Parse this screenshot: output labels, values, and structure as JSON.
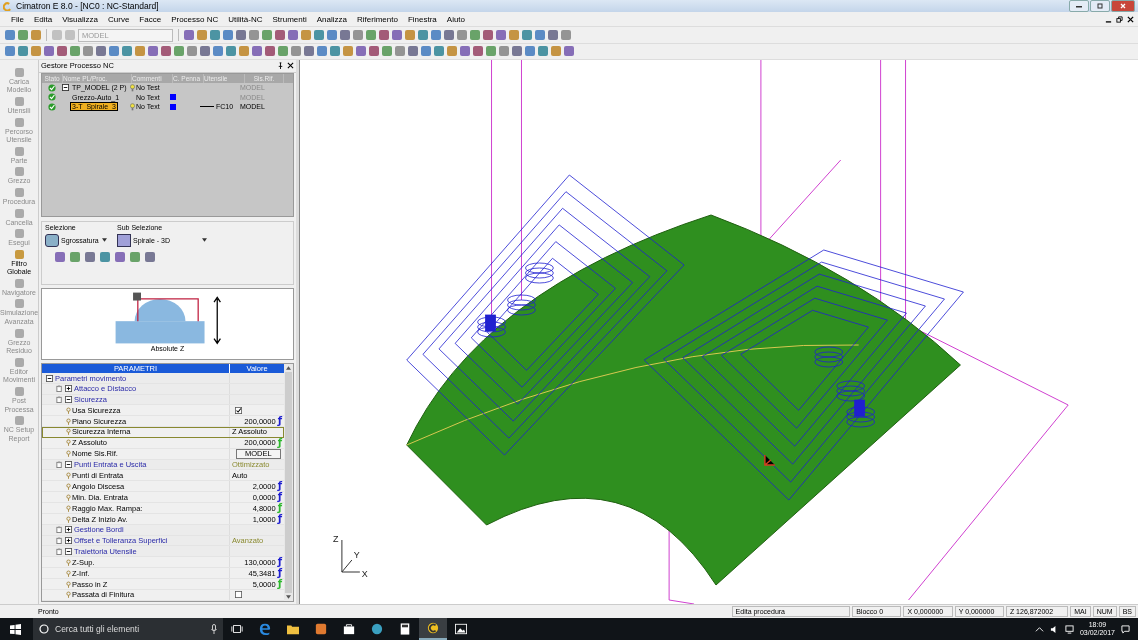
{
  "window": {
    "title": "Cimatron E 8.0 - [NC0 : NC-Standard]"
  },
  "menu": [
    "File",
    "Edita",
    "Visualizza",
    "Curve",
    "Facce",
    "Processo NC",
    "Utilità-NC",
    "Strumenti",
    "Analizza",
    "Riferimento",
    "Finestra",
    "Aiuto"
  ],
  "toolbar": {
    "model_field": {
      "value": "MODEL",
      "disabled": true
    }
  },
  "sidebar": {
    "items": [
      {
        "label": "Carica Modello",
        "disabled": true
      },
      {
        "label": "Utensili",
        "disabled": true
      },
      {
        "label": "Percorso Utensile",
        "disabled": true
      },
      {
        "label": "Parte",
        "disabled": true
      },
      {
        "label": "Grezzo",
        "disabled": true
      },
      {
        "label": "Procedura",
        "disabled": true
      },
      {
        "label": "Cancella",
        "disabled": true
      },
      {
        "label": "Esegui",
        "disabled": true
      },
      {
        "label": "Filtro Globale",
        "disabled": false
      },
      {
        "label": "Navigatore",
        "disabled": true
      },
      {
        "label": "Simulazione Avanzata",
        "disabled": true
      },
      {
        "label": "Grezzo Residuo",
        "disabled": true
      },
      {
        "label": "Editor Movimenti",
        "disabled": true
      },
      {
        "label": "Post Processa",
        "disabled": true
      },
      {
        "label": "NC Setup Report",
        "disabled": true
      }
    ]
  },
  "process_manager": {
    "title": "Gestore Processo NC",
    "columns": [
      "Stato",
      "Nome PL/Proc.",
      "Commenti",
      "C. Penna",
      "Utensile",
      "Sis.Rif."
    ],
    "rows": [
      {
        "name": "TP_MODEL (2 P)",
        "expanded": true,
        "bulb": true,
        "comment": "No Test",
        "sys": "MODEL",
        "dimmed": true,
        "selected": false
      },
      {
        "name": "Grezzo-Auto_1",
        "bulb": false,
        "comment": "No Text",
        "color": "#0000ff",
        "sys": "MODEL",
        "dimmed": true,
        "selected": false
      },
      {
        "name": "3-T_Spirale_3",
        "bulb": true,
        "comment": "No Text",
        "color": "#0000ff",
        "tool": "FC10",
        "sys": "MODEL",
        "dimmed": false,
        "selected": true
      }
    ]
  },
  "selection": {
    "label": "Selezione",
    "value": "Sgrossatura",
    "sub_label": "Sub Selezione",
    "sub_value": "Spirale - 3D"
  },
  "diagram": {
    "caption": "Absolute Z"
  },
  "params": {
    "columns": [
      "PARAMETRI",
      "Valore"
    ],
    "rows": [
      {
        "kind": "group",
        "label": "Parametri movimento",
        "expanded": true,
        "selected": false,
        "children": [
          {
            "kind": "group",
            "label": "Attacco e Distacco",
            "expanded": false,
            "selected": false
          },
          {
            "kind": "group",
            "label": "Sicurezza",
            "expanded": true,
            "selected": false,
            "children": [
              {
                "kind": "checkbox",
                "label": "Usa Sicurezza",
                "checked": true,
                "selected": false
              },
              {
                "kind": "number",
                "label": "Piano Sicurezza",
                "value": "200,0000",
                "func": {
                  "symbol": "ƒ",
                  "color": "#1c1cd0"
                },
                "selected": false
              },
              {
                "kind": "text",
                "label": "Sicurezza Interna",
                "value": "Z Assoluto",
                "selected": true
              },
              {
                "kind": "number",
                "label": "Z Assoluto",
                "value": "200,0000",
                "func": {
                  "symbol": "ƒ",
                  "color": "#2db82d"
                },
                "selected": false
              },
              {
                "kind": "button",
                "label": "Nome Sis.Rif.",
                "value": "MODEL",
                "selected": false
              }
            ]
          },
          {
            "kind": "group",
            "label": "Punti Entrata e Uscita",
            "value": "Ottimizzato",
            "expanded": true,
            "selected": false,
            "children": [
              {
                "kind": "text",
                "label": "Punti di Entrata",
                "value": "Auto",
                "selected": false
              },
              {
                "kind": "number",
                "label": "Angolo Discesa",
                "value": "2,0000",
                "func": {
                  "symbol": "ƒ",
                  "color": "#1c1cd0"
                },
                "selected": false
              },
              {
                "kind": "number",
                "label": "Min. Dia. Entrata",
                "value": "0,0000",
                "func": {
                  "symbol": "ƒ",
                  "color": "#1c1cd0"
                },
                "selected": false
              },
              {
                "kind": "number",
                "label": "Raggio Max. Rampa:",
                "value": "4,8000",
                "func": {
                  "symbol": "ƒ",
                  "color": "#2db82d"
                },
                "selected": false
              },
              {
                "kind": "number",
                "label": "Delta Z Inizio Av.",
                "value": "1,0000",
                "func": {
                  "symbol": "ƒ",
                  "color": "#1c1cd0"
                },
                "selected": false
              }
            ]
          },
          {
            "kind": "group",
            "label": "Gestione Bordi",
            "expanded": false,
            "selected": false
          },
          {
            "kind": "group",
            "label": "Offset e Tolleranza Superfici",
            "value": "Avanzato",
            "expanded": false,
            "selected": false
          },
          {
            "kind": "group",
            "label": "Traiettoria Utensile",
            "expanded": true,
            "selected": false,
            "children": [
              {
                "kind": "number",
                "label": "Z-Sup.",
                "value": "130,0000",
                "func": {
                  "symbol": "ƒ",
                  "color": "#1c1cd0"
                },
                "selected": false
              },
              {
                "kind": "number",
                "label": "Z-Inf.",
                "value": "45,3481",
                "func": {
                  "symbol": "ƒ",
                  "color": "#1c1cd0"
                },
                "selected": false
              },
              {
                "kind": "number",
                "label": "Passo in Z",
                "value": "5,0000",
                "func": {
                  "symbol": "ƒ",
                  "color": "#2db82d"
                },
                "selected": false
              },
              {
                "kind": "checkbox",
                "label": "Passata di Finitura",
                "checked": false,
                "selected": false
              }
            ]
          }
        ]
      }
    ]
  },
  "viewport": {
    "axes": {
      "z": "Z",
      "y": "Y",
      "x": "X"
    }
  },
  "status_bar": {
    "message": "Pronto",
    "mode": "Edita procedura",
    "block": "Blocco 0",
    "x": "X 0,000000",
    "y": "Y 0,000000",
    "z": "Z 126,872002",
    "indicators": [
      "MAI",
      "NUM",
      "BS"
    ]
  },
  "taskbar": {
    "search": {
      "placeholder": "Cerca tutti gli elementi"
    },
    "time": "18:09",
    "date": "03/02/2017"
  }
}
